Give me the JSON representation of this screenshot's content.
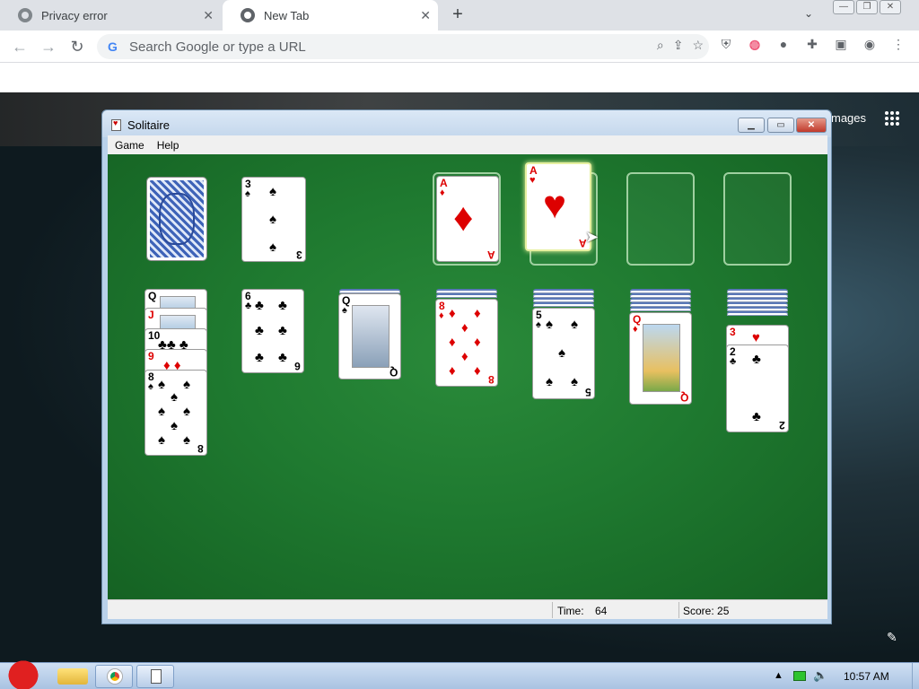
{
  "browser": {
    "tabs": [
      {
        "label": "Privacy error",
        "close": "✕"
      },
      {
        "label": "New Tab",
        "close": "✕"
      }
    ],
    "new_tab": "+",
    "tab_dropdown": "⌄",
    "window_controls": [
      "—",
      "❐",
      "✕"
    ],
    "omnibox": {
      "placeholder": "Search Google or type a URL",
      "g_glyph": "G"
    },
    "nav": {
      "back": "←",
      "forward": "→",
      "reload": "↻"
    },
    "omnibox_icons": [
      "⌕",
      "⇪",
      "☆"
    ],
    "extension_icons": [
      "shield-icon",
      "extension-badge-icon",
      "moon-icon",
      "puzzle-icon",
      "sidepanel-icon",
      "profile-icon",
      "menu-icon"
    ]
  },
  "ntp": {
    "images_link": "mages",
    "edit_glyph": "✎"
  },
  "solitaire": {
    "title": "Solitaire",
    "menu": [
      "Game",
      "Help"
    ],
    "status": {
      "time_label": "Time:",
      "time_value": "64",
      "score_label": "Score: 25"
    },
    "waste_card": {
      "rank": "3",
      "suit": "♠"
    },
    "foundations": [
      {
        "rank": "A",
        "suit": "♦"
      },
      {
        "rank": "A",
        "suit": "♥"
      }
    ],
    "tableau": [
      {
        "cards": [
          "Q",
          "J",
          "10",
          "9",
          "8"
        ],
        "top_suit": "♠"
      },
      {
        "cards": [
          "6"
        ],
        "top_suit": "♣"
      },
      {
        "cards": [
          "Q"
        ],
        "top_suit": "♠"
      },
      {
        "cards": [
          "8"
        ],
        "top_suit": "♦"
      },
      {
        "cards": [
          "5"
        ],
        "top_suit": "♠"
      },
      {
        "cards": [
          "Q"
        ],
        "top_suit": "♦"
      },
      {
        "cards": [
          "3",
          "2"
        ],
        "top_suit": "♣"
      }
    ]
  },
  "taskbar": {
    "clock": "10:57 AM",
    "tray_up": "▲"
  },
  "colors": {
    "felt": "#1f7a30",
    "red_suit": "#dd0000",
    "window_frame": "#b9d1ea"
  }
}
